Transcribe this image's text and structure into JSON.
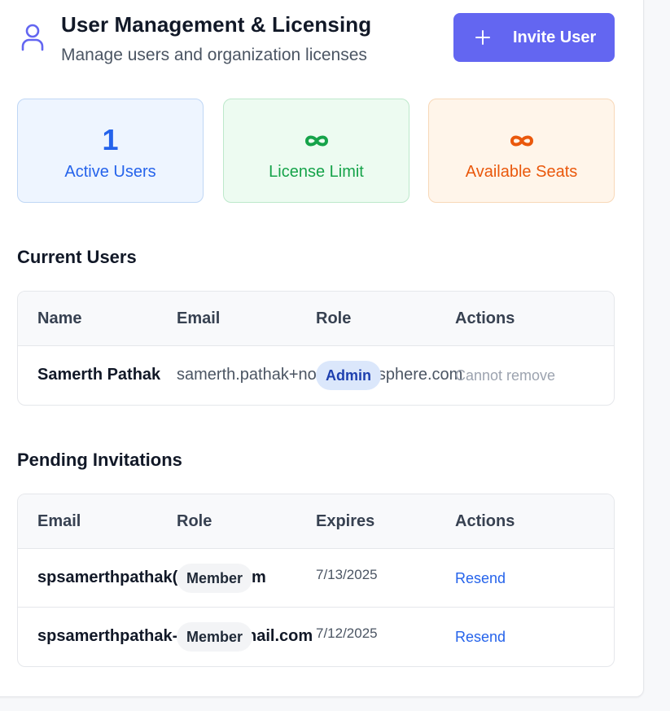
{
  "header": {
    "title": "User Management & Licensing",
    "subtitle": "Manage users and organization licenses",
    "invite_button": "Invite User",
    "icons": {
      "header": "user-icon",
      "invite": "plus-icon"
    }
  },
  "stats": [
    {
      "value": "1",
      "label": "Active Users",
      "color": "#2563eb"
    },
    {
      "value": "∞",
      "label": "License Limit",
      "color": "#16a34a"
    },
    {
      "value": "∞",
      "label": "Available Seats",
      "color": "#ea580c"
    }
  ],
  "current_users": {
    "title": "Current Users",
    "columns": [
      "Name",
      "Email",
      "Role",
      "Actions"
    ],
    "rows": [
      {
        "name": "Samerth Pathak",
        "email": "samerth.pathak+no",
        "email_end": "'sphere.com",
        "role": "Admin",
        "action": "Cannot remove"
      }
    ]
  },
  "pending_invitations": {
    "title": "Pending Invitations",
    "columns": [
      "Email",
      "Role",
      "Expires",
      "Actions"
    ],
    "rows": [
      {
        "email": "spsamerthpathak(",
        "email_end": "m",
        "role": "Member",
        "expires": "7/13/2025",
        "action": "Resend"
      },
      {
        "email": "spsamerthpathak-",
        "email_end": "nail.com",
        "role": "Member",
        "expires": "7/12/2025",
        "action": "Resend"
      }
    ]
  },
  "colors": {
    "accent": "#6366f1",
    "link": "#2563eb"
  }
}
